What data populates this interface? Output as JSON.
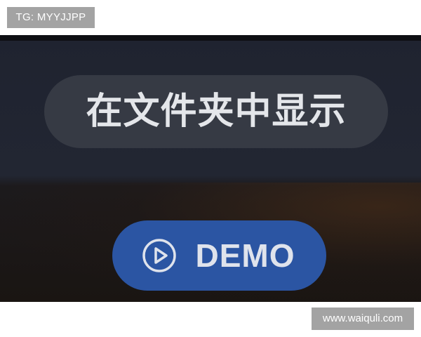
{
  "overlay": {
    "tg_label": "TG: MYYJJPP",
    "watermark": "www.waiquli.com"
  },
  "ui": {
    "show_in_folder_label": "在文件夹中显示",
    "demo_label": "DEMO",
    "demo_icon": "play-circle-icon"
  },
  "colors": {
    "pill_background": "#363a44",
    "demo_button_blue": "#2b55a3",
    "panel_background": "#222632"
  }
}
